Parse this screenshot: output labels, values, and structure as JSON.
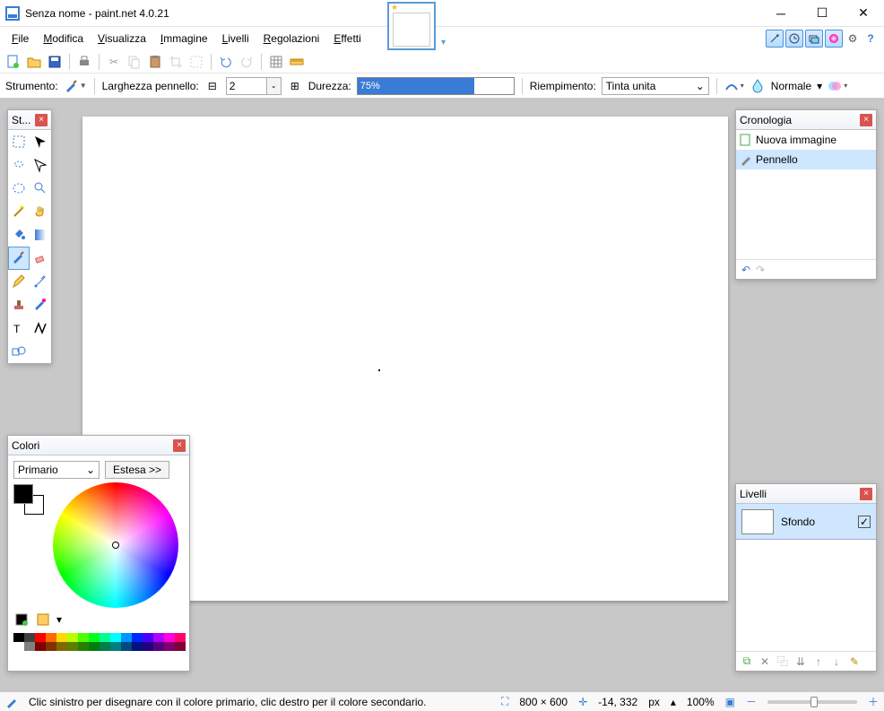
{
  "title": "Senza nome - paint.net 4.0.21",
  "menu": [
    "File",
    "Modifica",
    "Visualizza",
    "Immagine",
    "Livelli",
    "Regolazioni",
    "Effetti"
  ],
  "menu_underline_idx": [
    0,
    0,
    0,
    0,
    0,
    0,
    0
  ],
  "toolbar_icons": [
    "new",
    "open",
    "save",
    "print",
    "cut",
    "copy",
    "paste",
    "crop",
    "deselect",
    "undo",
    "redo",
    "grid",
    "ruler"
  ],
  "optbar": {
    "tool_label": "Strumento:",
    "brushwidth_label": "Larghezza pennello:",
    "brushwidth_value": "2",
    "hardness_label": "Durezza:",
    "hardness_value": "75%",
    "fill_label": "Riempimento:",
    "fill_value": "Tinta unita",
    "blend_label": "Normale"
  },
  "tools_panel_title": "St...",
  "tools": [
    "rect-select",
    "move",
    "lasso",
    "move-sel",
    "ellipse-sel",
    "zoom",
    "wand",
    "pan",
    "bucket",
    "gradient",
    "brush",
    "eraser",
    "pencil",
    "picker",
    "clone",
    "recolor",
    "text",
    "line",
    "shapes",
    ""
  ],
  "tools_active_index": 10,
  "history": {
    "title": "Cronologia",
    "items": [
      "Nuova immagine",
      "Pennello"
    ],
    "selected": 1
  },
  "layers": {
    "title": "Livelli",
    "rows": [
      {
        "name": "Sfondo",
        "visible": true
      }
    ]
  },
  "colors": {
    "title": "Colori",
    "target": "Primario",
    "more": "Estesa >>",
    "palette": [
      "#000",
      "#404040",
      "#ff0000",
      "#ff6a00",
      "#ffd800",
      "#b6ff00",
      "#4cff00",
      "#00ff21",
      "#00ff90",
      "#00ffff",
      "#0094ff",
      "#0026ff",
      "#4800ff",
      "#b200ff",
      "#ff00dc",
      "#ff006e",
      "#fff",
      "#808080",
      "#7f0000",
      "#7f3300",
      "#7f6a00",
      "#5b7f00",
      "#267f00",
      "#007f0e",
      "#007f46",
      "#007f7f",
      "#004a7f",
      "#00137f",
      "#24007f",
      "#57007f",
      "#7f006e",
      "#7f0037"
    ]
  },
  "status": {
    "hint": "Clic sinistro per disegnare con il colore primario, clic destro per il colore secondario.",
    "size": "800 × 600",
    "pos": "-14, 332",
    "unit": "px",
    "zoom": "100%"
  }
}
